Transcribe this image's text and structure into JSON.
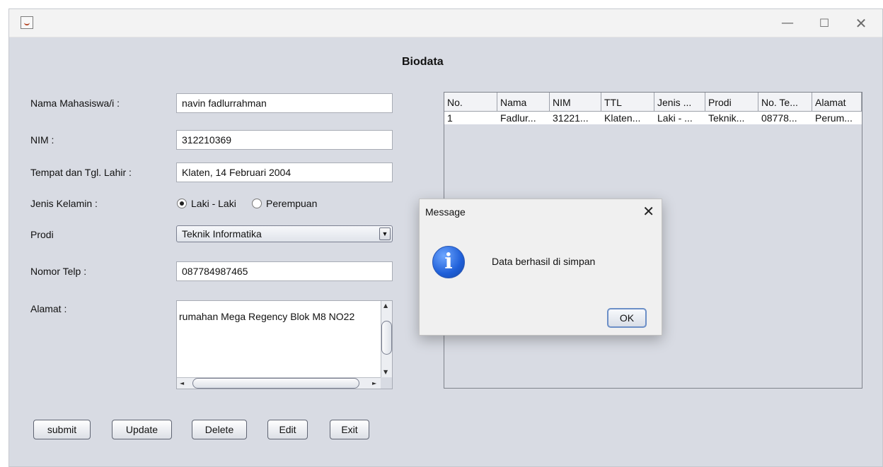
{
  "window": {
    "min_glyph": "—",
    "max_glyph": "☐",
    "close_glyph": "✕"
  },
  "form": {
    "heading": "Biodata",
    "nama_label": "Nama Mahasiswa/i  :",
    "nama_value": "navin fadlurrahman",
    "nim_label": "NIM :",
    "nim_value": "312210369",
    "ttl_label": "Tempat dan Tgl. Lahir :",
    "ttl_value": "Klaten, 14 Februari 2004",
    "jk_label": "Jenis Kelamin :",
    "jk_options": [
      "Laki - Laki",
      "Perempuan"
    ],
    "jk_selected": "Laki - Laki",
    "prodi_label": "Prodi",
    "prodi_value": "Teknik Informatika",
    "telp_label": "Nomor Telp :",
    "telp_value": "087784987465",
    "alamat_label": "Alamat :",
    "alamat_value": "rumahan Mega Regency Blok M8 NO22"
  },
  "buttons": {
    "submit": "submit",
    "update": "Update",
    "delete": "Delete",
    "edit": "Edit",
    "exit": "Exit"
  },
  "table": {
    "headers": [
      "No.",
      "Nama",
      "NIM",
      "TTL",
      "Jenis ...",
      "Prodi",
      "No. Te...",
      "Alamat"
    ],
    "rows": [
      [
        "1",
        "Fadlur...",
        "31221...",
        "Klaten...",
        "Laki - ...",
        "Teknik...",
        "08778...",
        "Perum..."
      ]
    ]
  },
  "dialog": {
    "title": "Message",
    "close_glyph": "✕",
    "icon_glyph": "i",
    "message": "Data berhasil di simpan",
    "ok_label": "OK"
  },
  "icons": [
    "java-app-icon",
    "info-icon",
    "dropdown-arrow-icon",
    "close-icon",
    "minimize-icon",
    "maximize-icon"
  ]
}
